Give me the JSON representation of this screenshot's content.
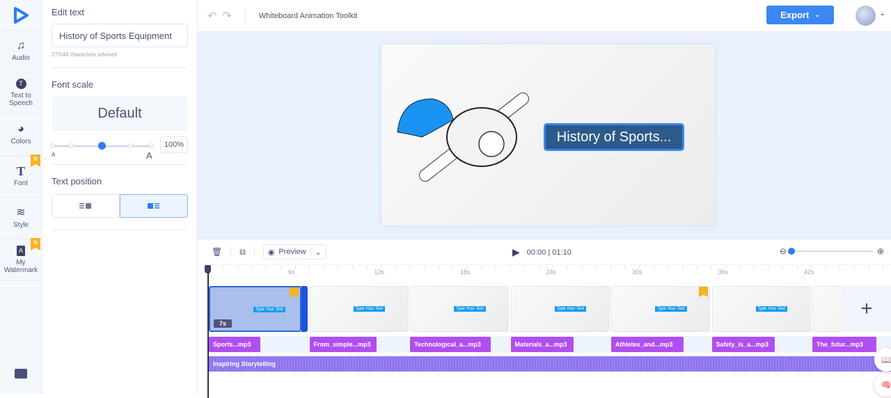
{
  "rail": {
    "items": [
      {
        "label": "Audio",
        "icon": "♫",
        "premium": false
      },
      {
        "label": "Text to Speech",
        "icon": "T",
        "premium": false
      },
      {
        "label": "Colors",
        "icon": "◕",
        "premium": false
      },
      {
        "label": "Font",
        "icon": "T",
        "premium": true
      },
      {
        "label": "Style",
        "icon": "≋",
        "premium": false
      },
      {
        "label": "My Watermark",
        "icon": "A",
        "premium": true
      }
    ]
  },
  "panel": {
    "edit_text_label": "Edit text",
    "edit_text_value": "History of Sports Equipment",
    "char_hint": "27/148  characters advised",
    "font_scale_label": "Font scale",
    "font_scale_value": "Default",
    "scale_percent": "100%",
    "scale_min_label": "A",
    "scale_max_label": "A",
    "text_position_label": "Text position"
  },
  "topbar": {
    "title": "Whiteboard Animation Toolkit",
    "export_label": "Export"
  },
  "canvas": {
    "text": "History of Sports..."
  },
  "timeline": {
    "preview_label": "Preview",
    "time_current": "00:00",
    "time_total": "01:10",
    "ruler_labels": [
      "6s",
      "12s",
      "18s",
      "24s",
      "30s",
      "36s",
      "42s"
    ],
    "scenes": [
      {
        "text": "Type Your Text",
        "duration": "7s",
        "selected": true,
        "premium": true
      },
      {
        "text": "Type Your Text",
        "premium": false
      },
      {
        "text": "Type Your Text",
        "premium": false
      },
      {
        "text": "Type Your Text",
        "premium": false
      },
      {
        "text": "Type Your Text",
        "premium": true
      },
      {
        "text": "Type Your Text",
        "premium": false
      },
      {
        "text": "",
        "premium": false
      }
    ],
    "audio_clips": [
      "Sports...mp3",
      "From_simple...mp3",
      "Technological_a...mp3",
      "Materials_a...mp3",
      "Athletes_and...mp3",
      "Safety_is_a...mp3",
      "The_futur...mp3"
    ],
    "music_track": "Inspiring Storytelling"
  }
}
